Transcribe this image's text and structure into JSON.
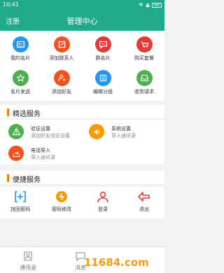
{
  "status": {
    "time": "10:41",
    "battery": "60"
  },
  "appbar": {
    "register": "注册",
    "title": "管理中心"
  },
  "grid": {
    "items": [
      {
        "label": "我的名片",
        "icon": "card-icon",
        "color": "#2196f3"
      },
      {
        "label": "添加联系人",
        "icon": "edit-icon",
        "color": "#f4511e"
      },
      {
        "label": "群名片",
        "icon": "group-card-icon",
        "color": "#e53935"
      },
      {
        "label": "购买套餐",
        "icon": "cart-icon",
        "color": "#e53935"
      },
      {
        "label": "名片发送",
        "icon": "star-icon",
        "color": "#4caf50"
      },
      {
        "label": "添加好友",
        "icon": "add-friend-icon",
        "color": "#f4511e"
      },
      {
        "label": "编辑分组",
        "icon": "list-icon",
        "color": "#2196f3"
      },
      {
        "label": "收到请求",
        "icon": "inbox-icon",
        "color": "#4caf50"
      }
    ]
  },
  "sections": {
    "featured": "精选服务",
    "quick": "便捷服务"
  },
  "services": [
    {
      "title": "验证设置",
      "desc": "添加好友验证设置",
      "icon": "warning-icon",
      "color": "#4caf50"
    },
    {
      "title": "系统设置",
      "desc": "导入通讯录",
      "icon": "volume-icon",
      "color": "#ff9800"
    },
    {
      "title": "电话导入",
      "desc": "导入通讯录",
      "icon": "import-icon",
      "color": "#f4511e"
    }
  ],
  "quick": [
    {
      "label": "找回密码",
      "icon": "plus-bracket-icon",
      "color": "#2196f3"
    },
    {
      "label": "密码修改",
      "icon": "lightning-icon",
      "color": "#ff9800"
    },
    {
      "label": "登录",
      "icon": "user-icon",
      "color": "#e53935"
    },
    {
      "label": "退出",
      "icon": "exit-arrow-icon",
      "color": "#e53935"
    }
  ],
  "tabs": [
    {
      "label": "通讯录",
      "icon": "contacts-icon"
    },
    {
      "label": "消息",
      "icon": "message-icon"
    }
  ],
  "watermark": "11684.com"
}
